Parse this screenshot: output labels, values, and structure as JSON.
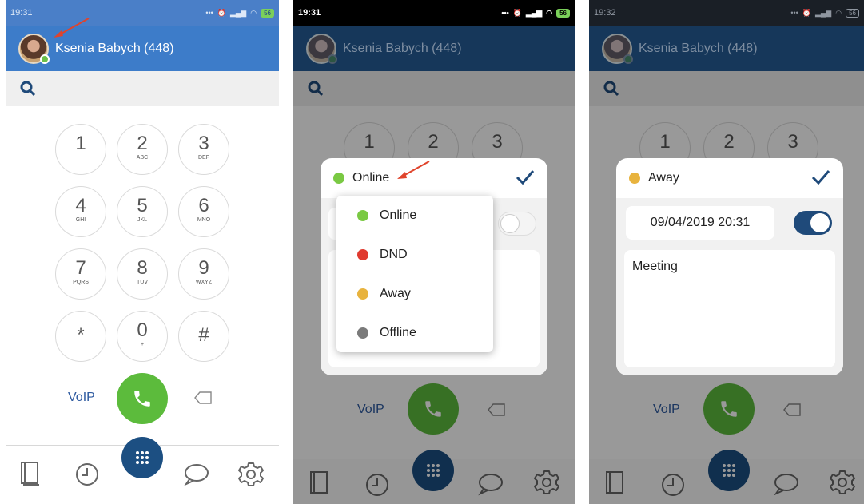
{
  "colors": {
    "online": "#7ac943",
    "dnd": "#e03a2f",
    "away": "#e8b33e",
    "offline": "#7a7a7a",
    "call": "#5cbb3c",
    "fab": "#1c4f82",
    "header_active": "#3d7cc9",
    "header_dim": "#16375a",
    "check": "#1f4a7a",
    "annotation_arrow": "#e0442c"
  },
  "panels": [
    {
      "status_bar": {
        "time": "19:31",
        "battery": "56"
      }
    },
    {
      "status_bar": {
        "time": "19:31",
        "battery": "56"
      }
    },
    {
      "status_bar": {
        "time": "19:32",
        "battery": "56"
      }
    }
  ],
  "user": {
    "name": "Ksenia Babych (448)"
  },
  "dialpad": {
    "keys": [
      {
        "digit": "1",
        "letters": ""
      },
      {
        "digit": "2",
        "letters": "ABC"
      },
      {
        "digit": "3",
        "letters": "DEF"
      },
      {
        "digit": "4",
        "letters": "GHI"
      },
      {
        "digit": "5",
        "letters": "JKL"
      },
      {
        "digit": "6",
        "letters": "MNO"
      },
      {
        "digit": "7",
        "letters": "PQRS"
      },
      {
        "digit": "8",
        "letters": "TUV"
      },
      {
        "digit": "9",
        "letters": "WXYZ"
      },
      {
        "digit": "*",
        "letters": ""
      },
      {
        "digit": "0",
        "letters": "+"
      },
      {
        "digit": "#",
        "letters": ""
      }
    ],
    "voip_label": "VoIP"
  },
  "icons": [
    "search-icon",
    "phone-icon",
    "backspace-icon",
    "contacts-icon",
    "history-icon",
    "dialpad-icon",
    "chat-icon",
    "settings-icon",
    "checkmark-icon",
    "signal-icon",
    "wifi-icon",
    "alarm-icon"
  ],
  "status_dialog": {
    "current": "Online",
    "options": [
      {
        "label": "Online",
        "color": "#7ac943"
      },
      {
        "label": "DND",
        "color": "#e03a2f"
      },
      {
        "label": "Away",
        "color": "#e8b33e"
      },
      {
        "label": "Offline",
        "color": "#7a7a7a"
      }
    ]
  },
  "away_dialog": {
    "status": "Away",
    "datetime": "09/04/2019 20:31",
    "toggle_on": true,
    "note": "Meeting"
  }
}
